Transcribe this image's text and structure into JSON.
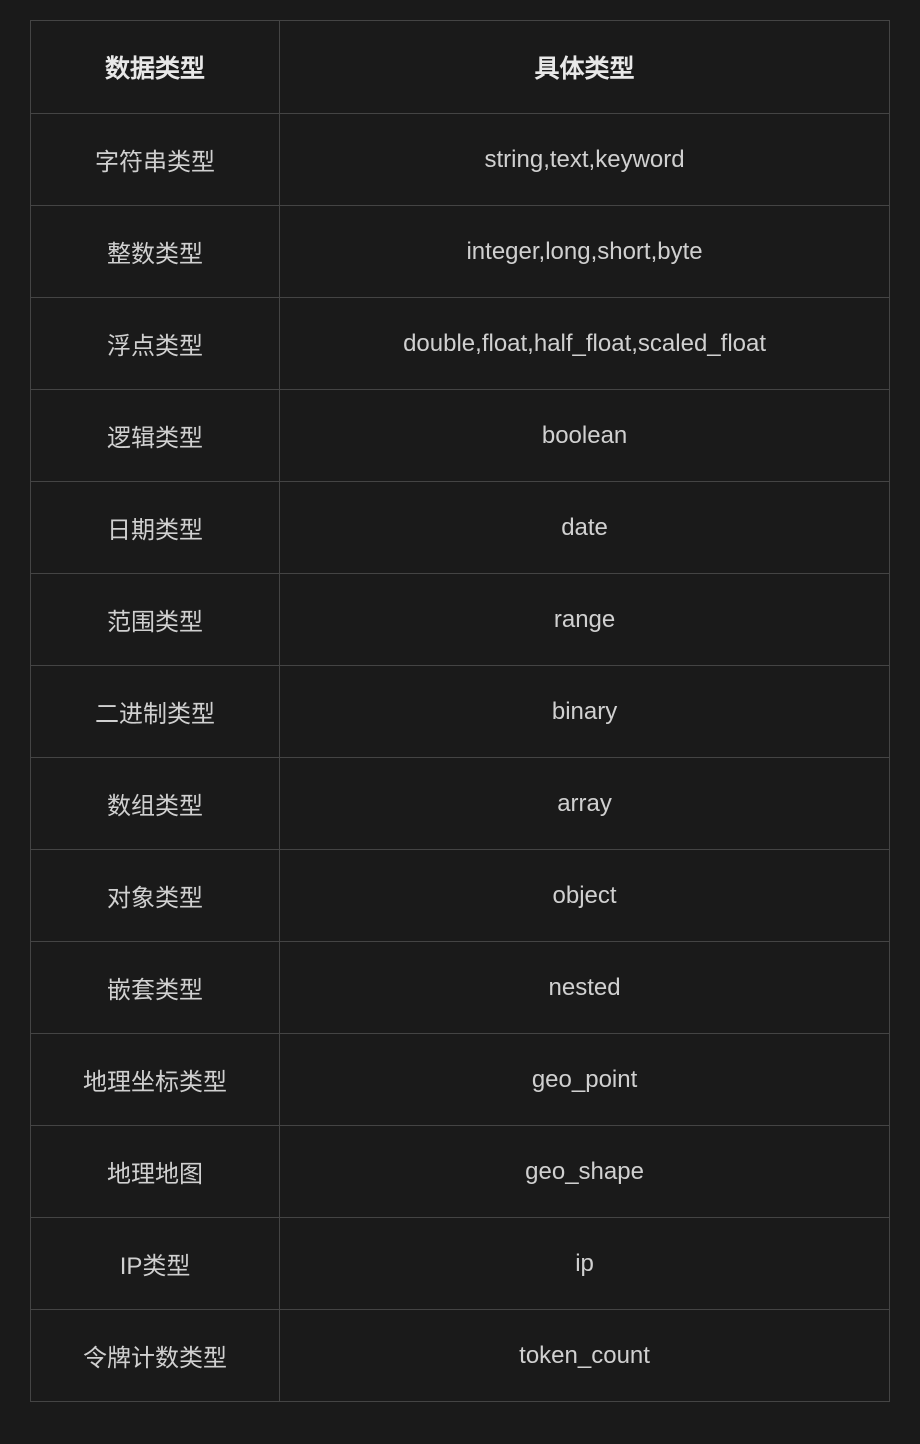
{
  "table": {
    "headers": [
      "数据类型",
      "具体类型"
    ],
    "rows": [
      {
        "category": "字符串类型",
        "types": "string,text,keyword"
      },
      {
        "category": "整数类型",
        "types": "integer,long,short,byte"
      },
      {
        "category": "浮点类型",
        "types": "double,float,half_float,scaled_float"
      },
      {
        "category": "逻辑类型",
        "types": "boolean"
      },
      {
        "category": "日期类型",
        "types": "date"
      },
      {
        "category": "范围类型",
        "types": "range"
      },
      {
        "category": "二进制类型",
        "types": "binary"
      },
      {
        "category": "数组类型",
        "types": "array"
      },
      {
        "category": "对象类型",
        "types": "object"
      },
      {
        "category": "嵌套类型",
        "types": "nested"
      },
      {
        "category": "地理坐标类型",
        "types": "geo_point"
      },
      {
        "category": "地理地图",
        "types": "geo_shape"
      },
      {
        "category": "IP类型",
        "types": "ip"
      },
      {
        "category": "令牌计数类型",
        "types": "token_count"
      }
    ]
  }
}
